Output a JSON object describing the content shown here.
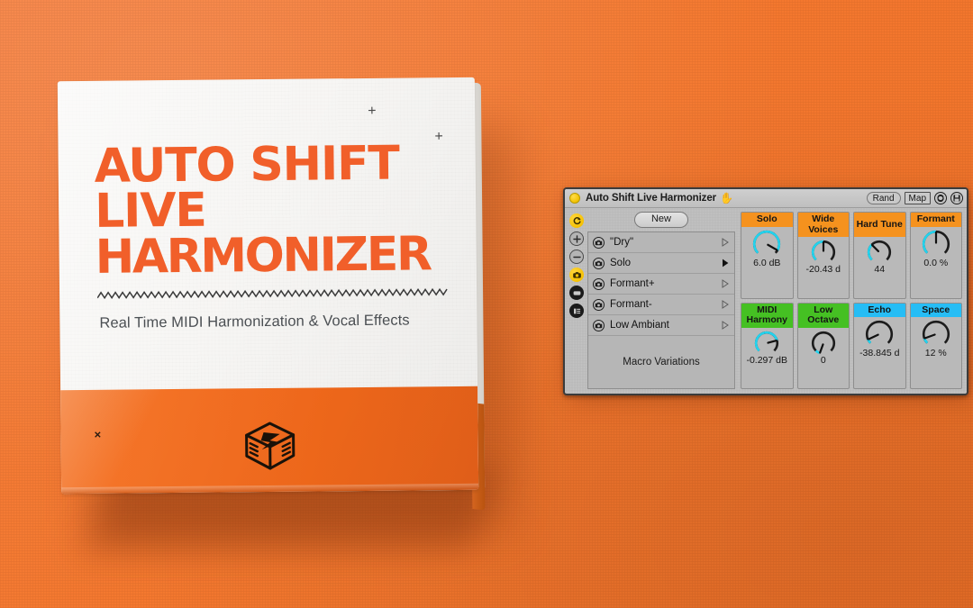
{
  "background": {
    "color": "#F4782F"
  },
  "product_box": {
    "headline_line1": "AUTO SHIFT",
    "headline_line2": "LIVE",
    "headline_line3": "HARMONIZER",
    "headline_color": "#F15F2A",
    "subtitle": "Real Time MIDI Harmonization & Vocal Effects",
    "marks": {
      "plus_1": "+",
      "plus_2": "+",
      "cross_1": "×"
    },
    "logo_name": "lightning-box-logo",
    "lower_panel_color": "#F2691B"
  },
  "device": {
    "activator_color": "#F2C200",
    "title": "Auto Shift Live Harmonizer",
    "hand_icon": "✋",
    "titlebar_buttons": {
      "rand_label": "Rand",
      "map_label": "Map",
      "refresh_icon": "circular-arrows-icon",
      "save_icon": "floppy-disk-icon"
    },
    "tool_rail": [
      {
        "name": "rail-item-randomize",
        "icon": "circular-arrow-icon",
        "style": "yellow"
      },
      {
        "name": "rail-item-add",
        "icon": "plus-icon",
        "style": "grey"
      },
      {
        "name": "rail-item-remove",
        "icon": "minus-icon",
        "style": "grey"
      },
      {
        "name": "rail-item-snapshot",
        "icon": "camera-icon",
        "style": "yellow"
      },
      {
        "name": "rail-item-single-view",
        "icon": "rounded-rect-icon",
        "style": "dark"
      },
      {
        "name": "rail-item-list-view",
        "icon": "list-icon",
        "style": "dark"
      }
    ],
    "new_button_label": "New",
    "chain_rows": [
      {
        "label": "\"Dry\"",
        "selected": false
      },
      {
        "label": "Solo",
        "selected": true
      },
      {
        "label": "Formant+",
        "selected": false
      },
      {
        "label": "Formant-",
        "selected": false
      },
      {
        "label": "Low Ambiant",
        "selected": false
      }
    ],
    "macro_variations_label": "Macro Variations",
    "macros": [
      {
        "title": "Solo",
        "value": "6.0 dB",
        "header_color": "#F5921E",
        "arc_start": -135,
        "arc_end": 120,
        "pointer": 120,
        "filled_from": -135
      },
      {
        "title": "Wide Voices",
        "value": "-20.43 d",
        "header_color": "#F5921E",
        "arc_start": -135,
        "arc_end": 0,
        "pointer": 0,
        "filled_from": -135
      },
      {
        "title": "Hard Tune",
        "value": "44",
        "header_color": "#F5921E",
        "arc_start": -135,
        "arc_end": -45,
        "pointer": -45,
        "filled_from": -135
      },
      {
        "title": "Formant",
        "value": "0.0 %",
        "header_color": "#F5921E",
        "arc_start": -135,
        "arc_end": 0,
        "pointer": 0,
        "filled_from": -135
      },
      {
        "title": "MIDI Harmony",
        "value": "-0.297 dB",
        "header_color": "#45C023",
        "arc_start": -135,
        "arc_end": 75,
        "pointer": 75,
        "filled_from": -135
      },
      {
        "title": "Low Octave",
        "value": "0",
        "header_color": "#45C023",
        "arc_start": -135,
        "arc_end": -160,
        "pointer": -160,
        "filled_from": -135
      },
      {
        "title": "Echo",
        "value": "-38.845 d",
        "header_color": "#26BDF5",
        "arc_start": -135,
        "arc_end": -115,
        "pointer": -115,
        "filled_from": -135
      },
      {
        "title": "Space",
        "value": "12 %",
        "header_color": "#26BDF5",
        "arc_start": -135,
        "arc_end": -110,
        "pointer": -110,
        "filled_from": -135
      }
    ],
    "knob_arc_color": "#22D3EE",
    "knob_track_color": "#1C1C1C"
  }
}
